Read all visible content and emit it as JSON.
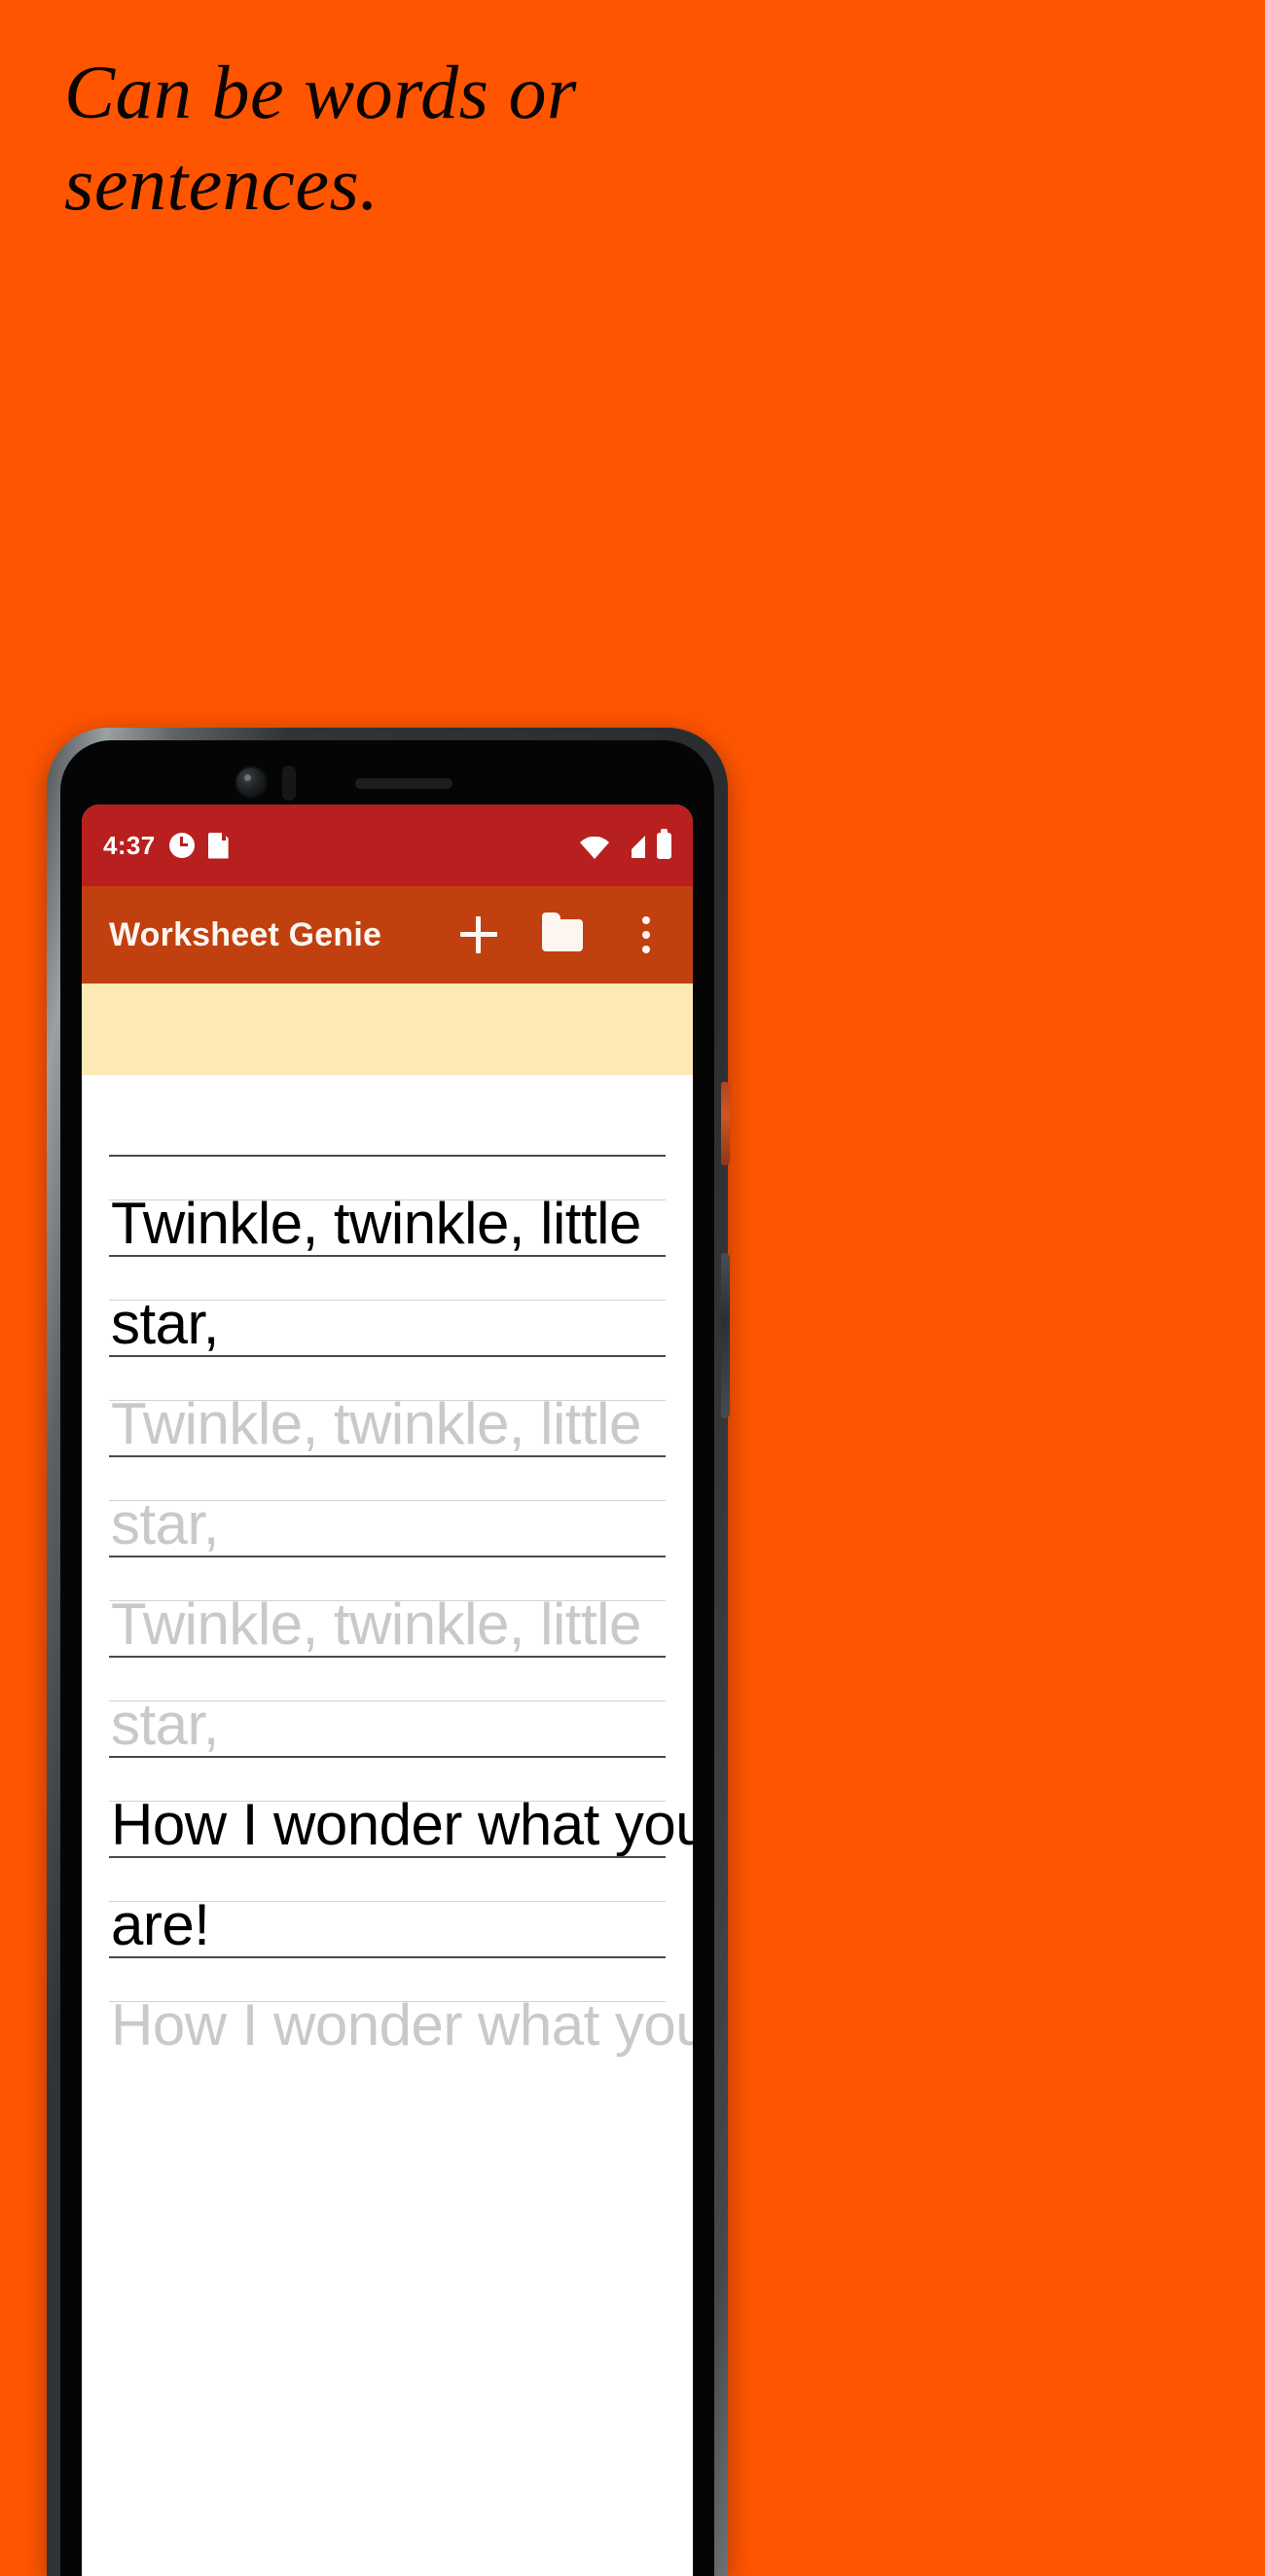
{
  "theme": {
    "background": "#ff5500",
    "statusbar_bg": "#b81f1f",
    "toolbar_bg": "#c1400f",
    "banner_bg": "#fce9b4",
    "model_text": "#000000",
    "trace_text": "#c9c9c9"
  },
  "headline": {
    "line1": "Can be words or",
    "line2": "sentences."
  },
  "phone": {
    "statusbar": {
      "clock": "4:37",
      "left_icons": [
        "alarm-icon",
        "sd-card-icon"
      ],
      "right_icons": [
        "wifi-icon",
        "cell-signal-icon",
        "battery-icon"
      ]
    },
    "toolbar": {
      "title": "Worksheet Genie",
      "actions": [
        {
          "name": "add-button",
          "icon": "plus-icon"
        },
        {
          "name": "open-folder-button",
          "icon": "folder-icon"
        },
        {
          "name": "overflow-menu-button",
          "icon": "kebab-menu-icon"
        }
      ]
    },
    "worksheet": {
      "lines": [
        {
          "text": "Twinkle, twinkle, little",
          "style": "model"
        },
        {
          "text": "star,",
          "style": "model"
        },
        {
          "text": "Twinkle, twinkle, little",
          "style": "trace"
        },
        {
          "text": "star,",
          "style": "trace"
        },
        {
          "text": "Twinkle, twinkle, little",
          "style": "trace"
        },
        {
          "text": "star,",
          "style": "trace"
        },
        {
          "text": "How I wonder what you",
          "style": "model"
        },
        {
          "text": "are!",
          "style": "model"
        },
        {
          "text": "How I wonder what you",
          "style": "trace"
        }
      ]
    }
  }
}
